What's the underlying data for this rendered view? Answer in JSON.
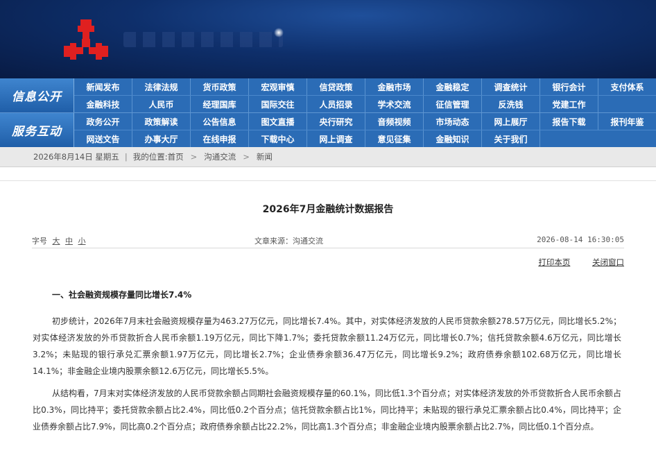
{
  "nav": {
    "info_label": "信息公开",
    "service_label": "服务互动",
    "info_row1": [
      "新闻发布",
      "法律法规",
      "货币政策",
      "宏观审慎",
      "信贷政策",
      "金融市场",
      "金融稳定",
      "调查统计",
      "银行会计",
      "支付体系"
    ],
    "info_row2": [
      "金融科技",
      "人民币",
      "经理国库",
      "国际交往",
      "人员招录",
      "学术交流",
      "征信管理",
      "反洗钱",
      "党建工作"
    ],
    "service_row1": [
      "政务公开",
      "政策解读",
      "公告信息",
      "图文直播",
      "央行研究",
      "音频视频",
      "市场动态",
      "网上展厅",
      "报告下载",
      "报刊年鉴"
    ],
    "service_row2": [
      "网送文告",
      "办事大厅",
      "在线申报",
      "下载中心",
      "网上调查",
      "意见征集",
      "金融知识",
      "关于我们"
    ]
  },
  "breadcrumb": {
    "date": "2026年8月14日 星期五",
    "sep": "|",
    "location_prefix": "我的位置:",
    "home": "首页",
    "item1": "沟通交流",
    "item2": "新闻",
    "chevron": ">"
  },
  "article": {
    "title": "2026年7月金融统计数据报告",
    "fontsize_label": "字号",
    "size_large": "大",
    "size_medium": "中",
    "size_small": "小",
    "source": "文章来源：沟通交流",
    "datetime": "2026-08-14 16:30:05",
    "print_label": "打印本页",
    "close_label": "关闭窗口",
    "section1_title": "一、社会融资规模存量同比增长7.4%",
    "para1": "初步统计，2026年7月末社会融资规模存量为463.27万亿元，同比增长7.4%。其中，对实体经济发放的人民币贷款余额278.57万亿元，同比增长5.2%；对实体经济发放的外币贷款折合人民币余额1.19万亿元，同比下降1.7%；委托贷款余额11.24万亿元，同比增长0.7%；信托贷款余额4.6万亿元，同比增长3.2%；未贴现的银行承兑汇票余额1.97万亿元，同比增长2.7%；企业债券余额36.47万亿元，同比增长9.2%；政府债券余额102.68万亿元，同比增长14.1%；非金融企业境内股票余额12.6万亿元，同比增长5.5%。",
    "para2": "从结构看，7月末对实体经济发放的人民币贷款余额占同期社会融资规模存量的60.1%，同比低1.3个百分点；对实体经济发放的外币贷款折合人民币余额占比0.3%，同比持平；委托贷款余额占比2.4%，同比低0.2个百分点；信托贷款余额占比1%，同比持平；未贴现的银行承兑汇票余额占比0.4%，同比持平；企业债券余额占比7.9%，同比高0.2个百分点；政府债券余额占比22.2%，同比高1.3个百分点；非金融企业境内股票余额占比2.7%，同比低0.1个百分点。"
  },
  "colors": {
    "nav_bg": "#2b6cb6",
    "banner_dark": "#081b44",
    "logo_red": "#e02020"
  }
}
